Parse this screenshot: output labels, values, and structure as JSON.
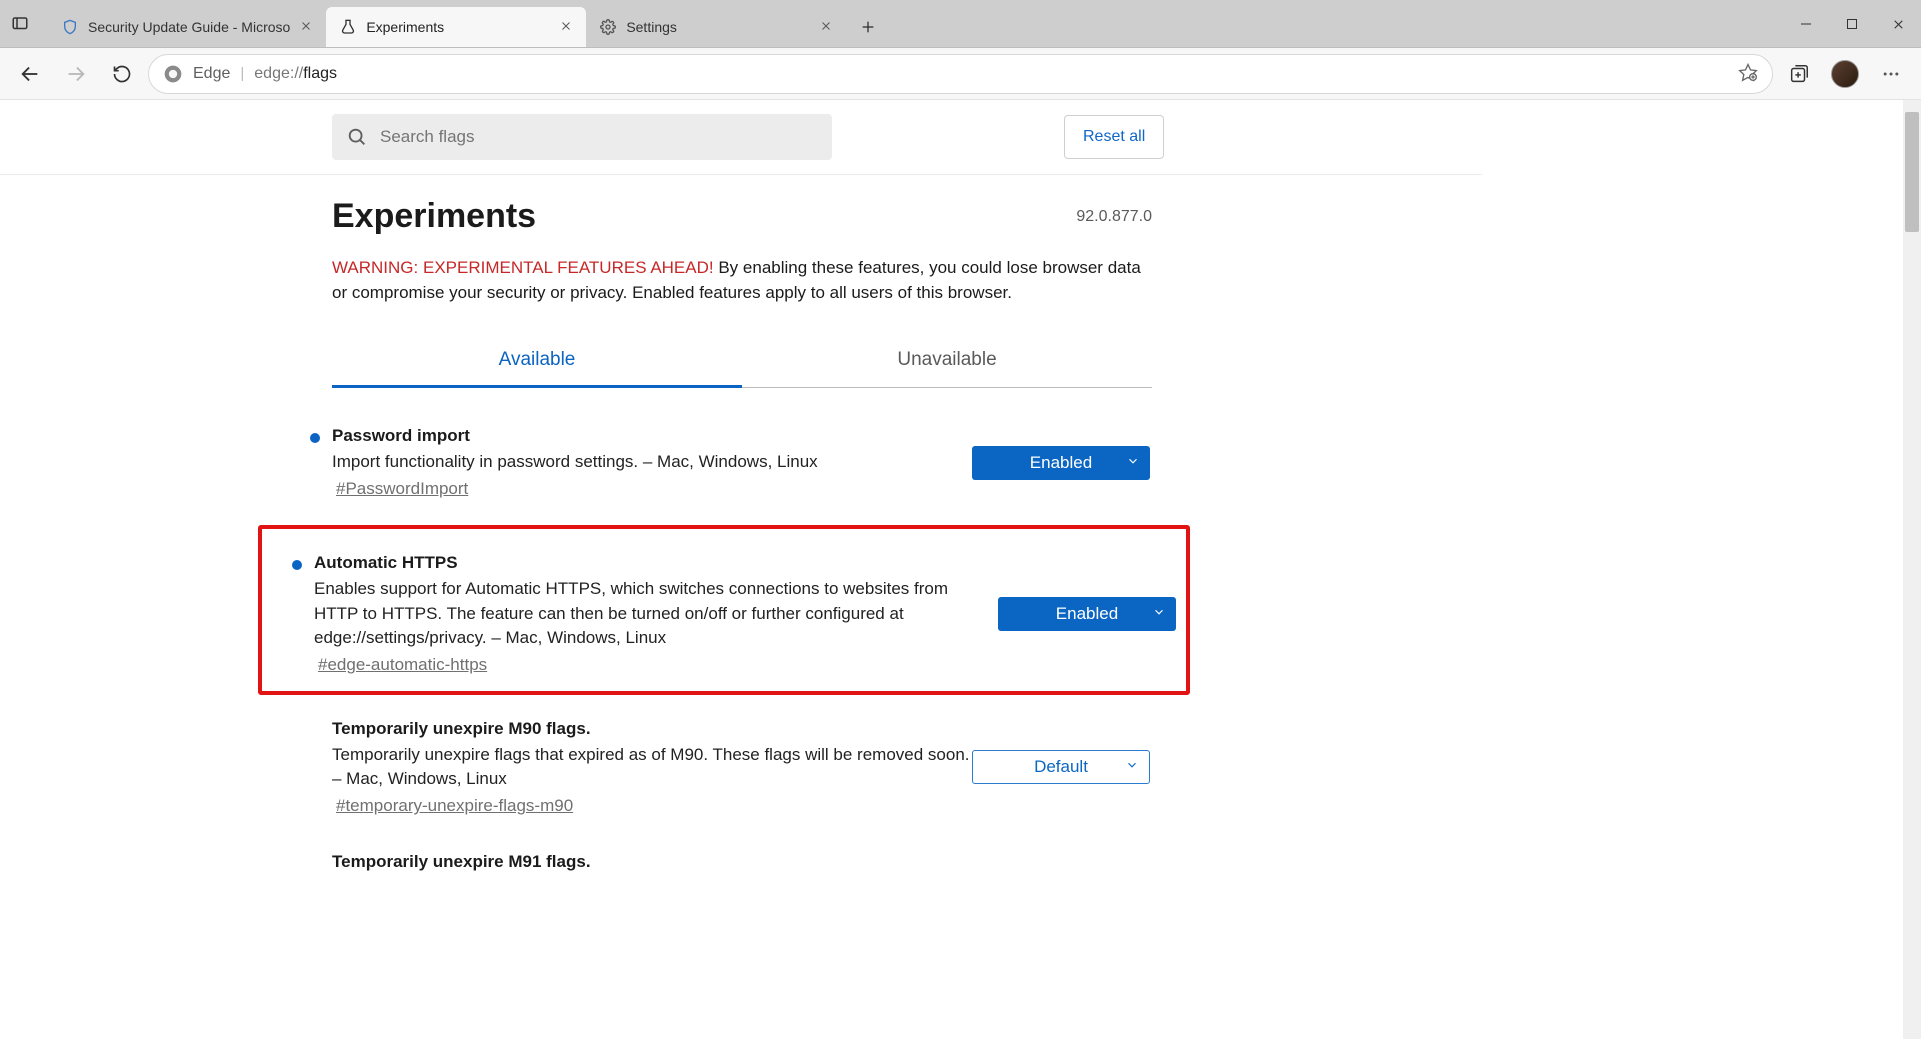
{
  "tabs_strip": {
    "items": [
      {
        "title": "Security Update Guide - Microso"
      },
      {
        "title": "Experiments"
      },
      {
        "title": "Settings"
      }
    ],
    "active_index": 1
  },
  "addressbar": {
    "browser_label": "Edge",
    "url_prefix": "edge://",
    "url_path": "flags"
  },
  "searchbar": {
    "placeholder": "Search flags"
  },
  "reset_button": "Reset all",
  "heading": "Experiments",
  "version": "92.0.877.0",
  "warning_bold": "WARNING: EXPERIMENTAL FEATURES AHEAD!",
  "warning_rest": " By enabling these features, you could lose browser data or compromise your security or privacy. Enabled features apply to all users of this browser.",
  "filter_tabs": {
    "available": "Available",
    "unavailable": "Unavailable",
    "active": "available"
  },
  "flags": [
    {
      "title": "Password import",
      "desc": "Import functionality in password settings. – Mac, Windows, Linux",
      "link": "#PasswordImport",
      "select": "Enabled",
      "style": "enabled",
      "bullet": true
    },
    {
      "title": "Automatic HTTPS",
      "desc": "Enables support for Automatic HTTPS, which switches connections to websites from HTTP to HTTPS. The feature can then be turned on/off or further configured at edge://settings/privacy. – Mac, Windows, Linux",
      "link": "#edge-automatic-https",
      "select": "Enabled",
      "style": "enabled",
      "bullet": true,
      "highlight": true
    },
    {
      "title": "Temporarily unexpire M90 flags.",
      "desc": "Temporarily unexpire flags that expired as of M90. These flags will be removed soon. – Mac, Windows, Linux",
      "link": "#temporary-unexpire-flags-m90",
      "select": "Default",
      "style": "default",
      "bullet": false
    },
    {
      "title": "Temporarily unexpire M91 flags.",
      "desc": "",
      "link": "",
      "select": "",
      "style": "",
      "bullet": false
    }
  ]
}
